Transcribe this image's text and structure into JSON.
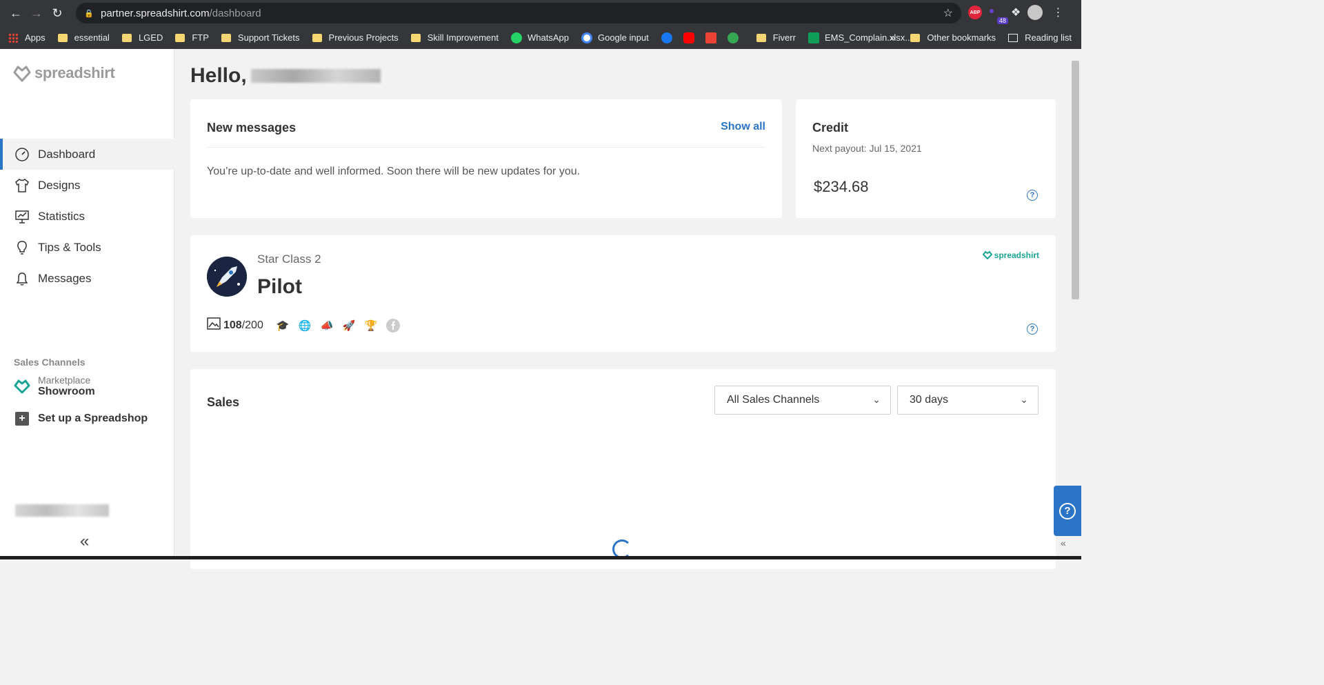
{
  "browser": {
    "url_host": "partner.spreadshirt.com",
    "url_path": "/dashboard",
    "extension_badge": "48",
    "abp_label": "ABP",
    "bookmarks": [
      {
        "label": "Apps",
        "icon": "apps-grid-icon"
      },
      {
        "label": "essential",
        "icon": "folder-icon"
      },
      {
        "label": "LGED",
        "icon": "folder-icon"
      },
      {
        "label": "FTP",
        "icon": "folder-icon"
      },
      {
        "label": "Support Tickets",
        "icon": "folder-icon"
      },
      {
        "label": "Previous Projects",
        "icon": "folder-icon"
      },
      {
        "label": "Skill Improvement",
        "icon": "folder-icon"
      },
      {
        "label": "WhatsApp",
        "icon": "whatsapp-icon"
      },
      {
        "label": "Google input",
        "icon": "google-icon"
      },
      {
        "label": "",
        "icon": "facebook-icon"
      },
      {
        "label": "",
        "icon": "youtube-icon"
      },
      {
        "label": "",
        "icon": "gmail-icon"
      },
      {
        "label": "",
        "icon": "maps-icon"
      },
      {
        "label": "Fiverr",
        "icon": "folder-icon"
      },
      {
        "label": "EMS_Complain.xlsx...",
        "icon": "sheets-icon"
      }
    ],
    "overflow": "»",
    "other_bookmarks": "Other bookmarks",
    "reading_list": "Reading list"
  },
  "sidebar": {
    "logo_text": "spreadshirt",
    "nav": [
      {
        "label": "Dashboard",
        "icon": "dashboard-gauge-icon",
        "active": true
      },
      {
        "label": "Designs",
        "icon": "tshirt-icon",
        "active": false
      },
      {
        "label": "Statistics",
        "icon": "presentation-chart-icon",
        "active": false
      },
      {
        "label": "Tips & Tools",
        "icon": "lightbulb-icon",
        "active": false
      },
      {
        "label": "Messages",
        "icon": "bell-icon",
        "active": false
      }
    ],
    "sales_channels_title": "Sales Channels",
    "marketplace_label": "Marketplace",
    "showroom_label": "Showroom",
    "setup_label": "Set up a Spreadshop",
    "collapse_label": "«"
  },
  "main": {
    "greeting": "Hello,",
    "messages": {
      "title": "New messages",
      "show_all": "Show all",
      "body": "You’re up-to-date and well informed. Soon there will be new updates for you."
    },
    "credit": {
      "title": "Credit",
      "next_payout": "Next payout: Jul 15, 2021",
      "amount": "$234.68"
    },
    "star": {
      "class_label": "Star Class 2",
      "rank": "Pilot",
      "brand": "spreadshirt",
      "designs_count": "108",
      "designs_limit": "/200"
    },
    "sales": {
      "title": "Sales",
      "channel_select": "All Sales Channels",
      "period_select": "30 days"
    }
  },
  "colors": {
    "accent": "#2a75c7",
    "brand_teal": "#1aa394"
  }
}
